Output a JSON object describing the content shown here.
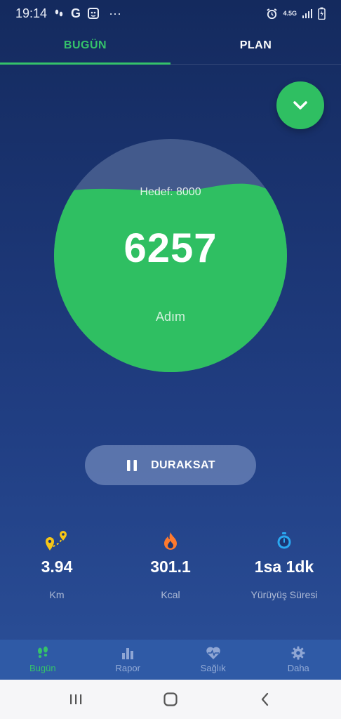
{
  "status_bar": {
    "time": "19:14",
    "more": "···",
    "network": "4.5G",
    "icons": [
      "steps-icon",
      "google-icon",
      "app-icon",
      "alarm-icon",
      "network-icon",
      "signal-icon",
      "battery-icon"
    ]
  },
  "tabs": [
    {
      "label": "BUGÜN",
      "active": true
    },
    {
      "label": "PLAN",
      "active": false
    }
  ],
  "collapse_button": {
    "icon": "chevron-down-icon"
  },
  "step_counter": {
    "goal_label": "Hedef: 8000",
    "steps": "6257",
    "unit_label": "Adım",
    "goal": 8000,
    "progress_fraction": 0.78
  },
  "pause_button": {
    "label": "DURAKSAT",
    "icon": "pause-icon"
  },
  "stats": [
    {
      "icon": "distance-icon",
      "value": "3.94",
      "label": "Km"
    },
    {
      "icon": "flame-icon",
      "value": "301.1",
      "label": "Kcal"
    },
    {
      "icon": "stopwatch-icon",
      "value": "1sa 1dk",
      "label": "Yürüyüş Süresi"
    }
  ],
  "bottom_nav": [
    {
      "icon": "footsteps-icon",
      "label": "Bugün",
      "active": true
    },
    {
      "icon": "bar-chart-icon",
      "label": "Rapor",
      "active": false
    },
    {
      "icon": "heart-icon",
      "label": "Sağlık",
      "active": false
    },
    {
      "icon": "gear-icon",
      "label": "Daha",
      "active": false
    }
  ],
  "colors": {
    "accent": "#35c26a",
    "circle_fill": "#2fbf62",
    "background_top": "#142a5e",
    "background_bottom": "#2b4f98",
    "nav_background": "#2f5aa6"
  }
}
